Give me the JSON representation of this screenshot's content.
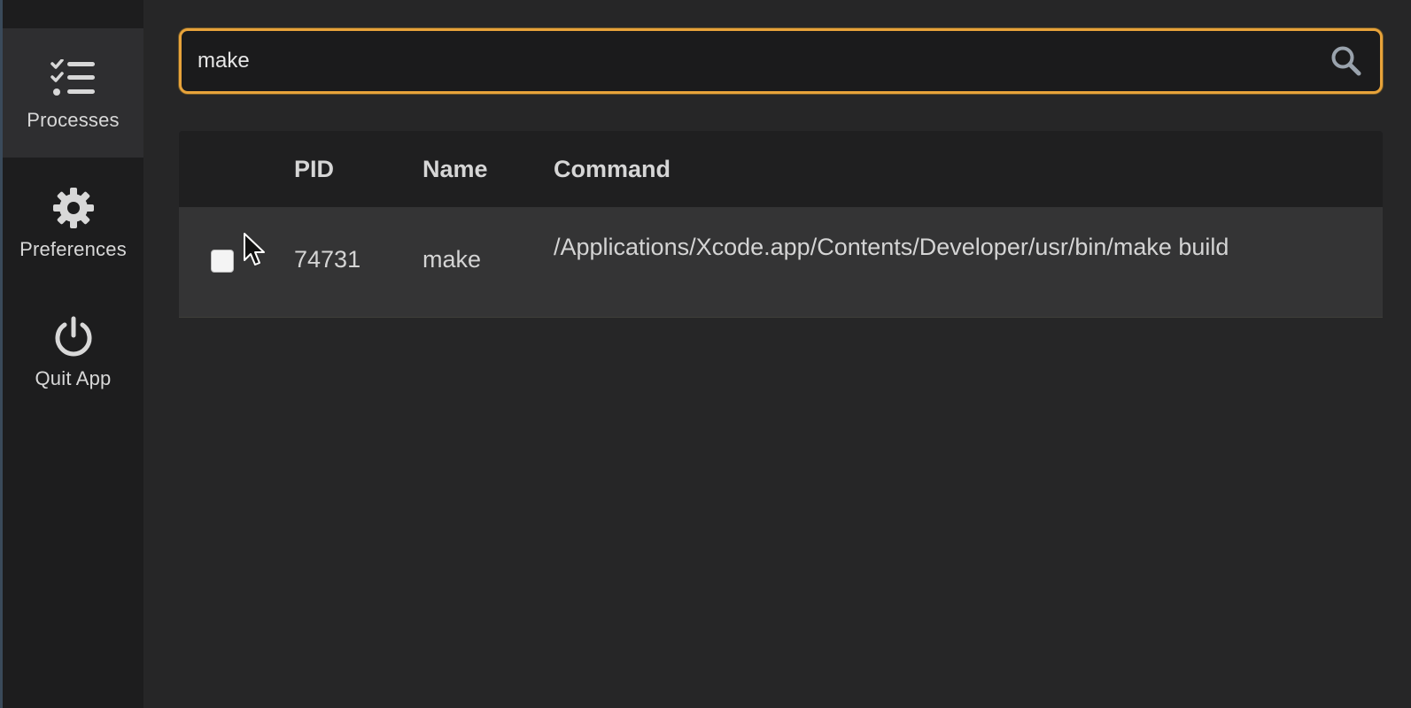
{
  "sidebar": {
    "items": [
      {
        "label": "Processes",
        "icon": "task-list-icon",
        "active": true
      },
      {
        "label": "Preferences",
        "icon": "gear-icon",
        "active": false
      },
      {
        "label": "Quit App",
        "icon": "power-icon",
        "active": false
      }
    ]
  },
  "search": {
    "value": "make",
    "placeholder": ""
  },
  "table": {
    "columns": [
      "",
      "PID",
      "Name",
      "Command"
    ],
    "rows": [
      {
        "checked": false,
        "pid": "74731",
        "name": "make",
        "command": "/Applications/Xcode.app/Contents/Developer/usr/bin/make build"
      }
    ]
  },
  "colors": {
    "accent": "#e8a33a",
    "sidebar_bg": "#1d1d1e",
    "main_bg": "#262627",
    "row_bg": "#343435"
  }
}
